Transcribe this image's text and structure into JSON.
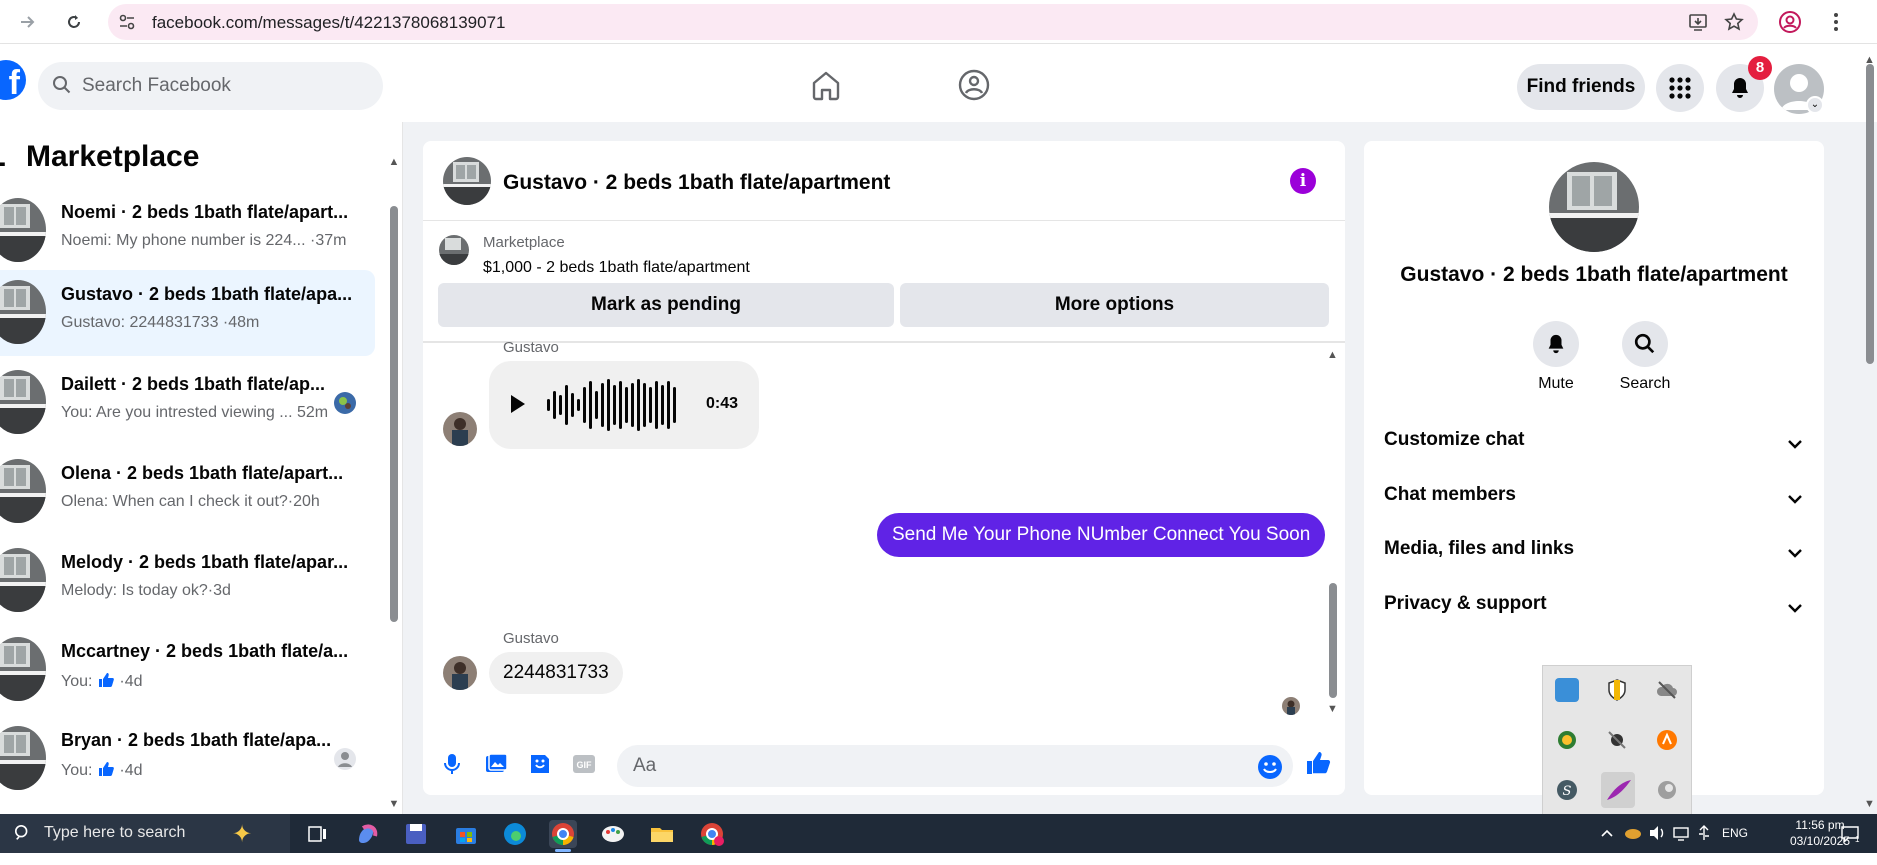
{
  "browser": {
    "url": "facebook.com/messages/t/4221378068139071"
  },
  "header": {
    "search_placeholder": "Search Facebook",
    "find_friends_label": "Find friends",
    "notification_count": "8"
  },
  "sidebar": {
    "heading": "Marketplace",
    "conversations": [
      {
        "title": "Noemi · 2 beds 1bath flate/apart...",
        "snippet": "Noemi: My phone number is 224... ·37m",
        "active": false
      },
      {
        "title": "Gustavo · 2 beds 1bath flate/apa...",
        "snippet": "Gustavo: 2244831733 ·48m",
        "active": true
      },
      {
        "title": "Dailett · 2 beds 1bath flate/ap...",
        "snippet": "You: Are you intrested viewing ... 52m",
        "active": false
      },
      {
        "title": "Olena · 2 beds 1bath flate/apart...",
        "snippet": "Olena: When can I check it out?·20h",
        "active": false
      },
      {
        "title": "Melody · 2 beds 1bath flate/apar...",
        "snippet": "Melody: Is today ok?·3d",
        "active": false
      },
      {
        "title": "Mccartney · 2 beds 1bath flate/a...",
        "snippet_prefix": "You:",
        "snippet": "·4d",
        "active": false
      },
      {
        "title": "Bryan · 2 beds 1bath flate/apa...",
        "snippet_prefix": "You:",
        "snippet": "·4d",
        "active": false
      }
    ]
  },
  "chat": {
    "title": "Gustavo · 2 beds 1bath flate/apartment",
    "marketplace_label": "Marketplace",
    "listing": "$1,000 - 2 beds 1bath flate/apartment",
    "mark_pending_label": "Mark as pending",
    "more_options_label": "More options",
    "messages": [
      {
        "sender": "Gustavo",
        "type": "audio",
        "duration": "0:43"
      },
      {
        "sender": "You",
        "type": "text",
        "text": "Send Me Your Phone NUmber  Connect You Soon"
      },
      {
        "sender": "Gustavo",
        "type": "text",
        "text": "2244831733"
      }
    ],
    "composer_placeholder": "Aa"
  },
  "details": {
    "title": "Gustavo · 2 beds 1bath flate/apartment",
    "actions": [
      {
        "label": "Mute",
        "icon": "bell-icon"
      },
      {
        "label": "Search",
        "icon": "search-icon"
      }
    ],
    "sections": [
      "Customize chat",
      "Chat members",
      "Media, files and links",
      "Privacy & support"
    ]
  },
  "taskbar": {
    "search_text": "Type here to search",
    "lang": "ENG",
    "time": "11:56 pm",
    "date": "03/10/2025"
  },
  "colors": {
    "fb_blue": "#0866ff",
    "outgoing_bubble": "#6023e6",
    "info_purple": "#9b00d9",
    "badge_red": "#e41e3f"
  }
}
